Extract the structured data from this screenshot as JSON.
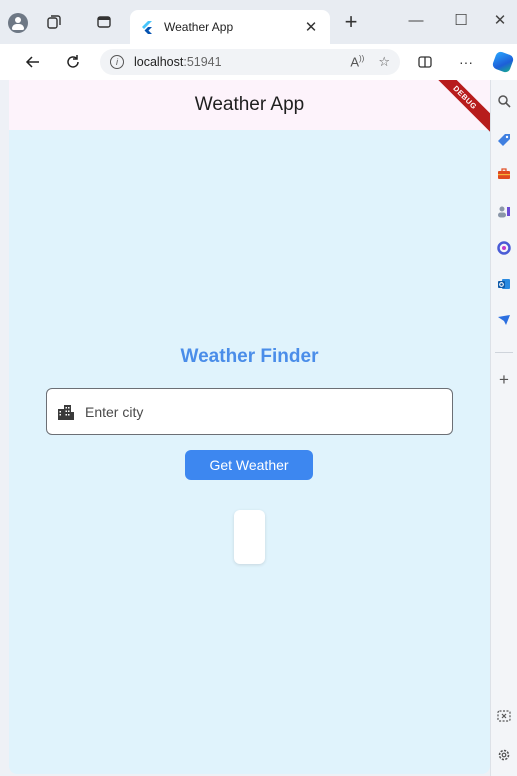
{
  "browser": {
    "tab_title": "Weather App",
    "tab_close": "✕",
    "new_tab": "+",
    "window_controls": {
      "minimize": "—",
      "maximize": "☐",
      "close": "✕"
    },
    "address": {
      "host": "localhost",
      "port": ":51941"
    },
    "more_label": "···"
  },
  "app": {
    "title": "Weather App",
    "debug_banner": "DEBUG",
    "finder_title": "Weather Finder",
    "city_input": {
      "placeholder": "Enter city",
      "value": ""
    },
    "get_weather_label": "Get Weather"
  },
  "colors": {
    "accent": "#3d87f0",
    "finder_title": "#4a8de9",
    "page_background": "#e0f3fc",
    "appbar_background": "#fdf3fb",
    "debug_banner": "#b71c1c"
  },
  "icons": {
    "profile": "profile-icon",
    "workspaces": "workspaces-icon",
    "tab_actions": "tab-actions-icon",
    "flutter": "flutter-icon",
    "back": "back-arrow-icon",
    "refresh": "refresh-icon",
    "site_info": "info-icon",
    "read_aloud": "read-aloud-icon",
    "favorite": "star-icon",
    "split_screen": "split-screen-icon",
    "copilot": "copilot-icon",
    "city": "city-icon",
    "sidebar": [
      "search-icon",
      "tag-icon",
      "toolbox-icon",
      "people-icon",
      "office-icon",
      "outlook-icon",
      "send-icon",
      "add-icon",
      "screenshot-icon",
      "settings-icon"
    ]
  }
}
